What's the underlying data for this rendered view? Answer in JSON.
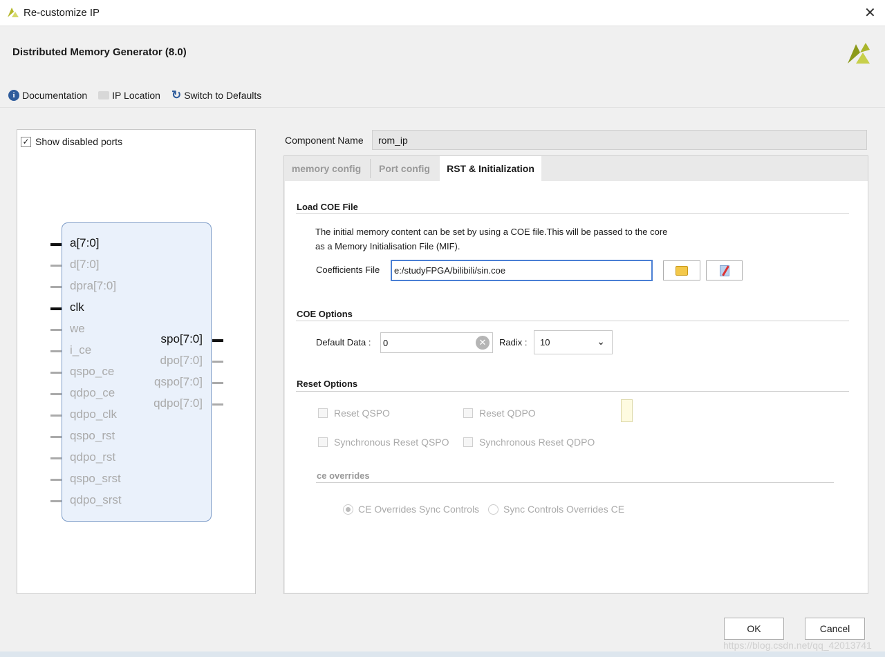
{
  "window": {
    "title": "Re-customize IP",
    "close_icon": "close-icon"
  },
  "header": {
    "title": "Distributed Memory Generator (8.0)"
  },
  "toolbar": {
    "documentation": "Documentation",
    "ip_location": "IP Location",
    "switch_defaults": "Switch to Defaults"
  },
  "symbol": {
    "show_disabled_ports": "Show disabled ports",
    "show_disabled_checked": true,
    "left_ports": [
      {
        "name": "a[7:0]",
        "enabled": true,
        "bus": true
      },
      {
        "name": "d[7:0]",
        "enabled": false
      },
      {
        "name": "dpra[7:0]",
        "enabled": false
      },
      {
        "name": "clk",
        "enabled": true
      },
      {
        "name": "we",
        "enabled": false
      },
      {
        "name": "i_ce",
        "enabled": false
      },
      {
        "name": "qspo_ce",
        "enabled": false
      },
      {
        "name": "qdpo_ce",
        "enabled": false
      },
      {
        "name": "qdpo_clk",
        "enabled": false
      },
      {
        "name": "qspo_rst",
        "enabled": false
      },
      {
        "name": "qdpo_rst",
        "enabled": false
      },
      {
        "name": "qspo_srst",
        "enabled": false
      },
      {
        "name": "qdpo_srst",
        "enabled": false
      }
    ],
    "right_ports": [
      {
        "name": "spo[7:0]",
        "enabled": true
      },
      {
        "name": "dpo[7:0]",
        "enabled": false
      },
      {
        "name": "qspo[7:0]",
        "enabled": false
      },
      {
        "name": "qdpo[7:0]",
        "enabled": false
      }
    ]
  },
  "component": {
    "label": "Component Name",
    "value": "rom_ip"
  },
  "tabs": [
    {
      "label": "memory config",
      "active": false
    },
    {
      "label": "Port config",
      "active": false
    },
    {
      "label": "RST & Initialization",
      "active": true
    }
  ],
  "load_coe": {
    "title": "Load COE File",
    "desc1": "The initial memory content can be set by using a COE file.This will be passed to the core",
    "desc2": "as a Memory Initialisation File (MIF).",
    "coef_label": "Coefficients File",
    "coef_value": "e:/studyFPGA/bilibili/sin.coe"
  },
  "coe_options": {
    "title": "COE Options",
    "default_label": "Default Data :",
    "default_value": "0",
    "radix_label": "Radix :",
    "radix_value": "10"
  },
  "reset": {
    "title": "Reset Options",
    "reset_qspo": "Reset QSPO",
    "reset_qdpo": "Reset QDPO",
    "sync_qspo": "Synchronous Reset QSPO",
    "sync_qdpo": "Synchronous Reset QDPO",
    "ce_title": "ce overrides",
    "ce_opt1": "CE Overrides Sync Controls",
    "ce_opt2": "Sync Controls Overrides CE",
    "ce_selected": "CE Overrides Sync Controls"
  },
  "buttons": {
    "ok": "OK",
    "cancel": "Cancel"
  },
  "watermark": "https://blog.csdn.net/qq_42013741"
}
